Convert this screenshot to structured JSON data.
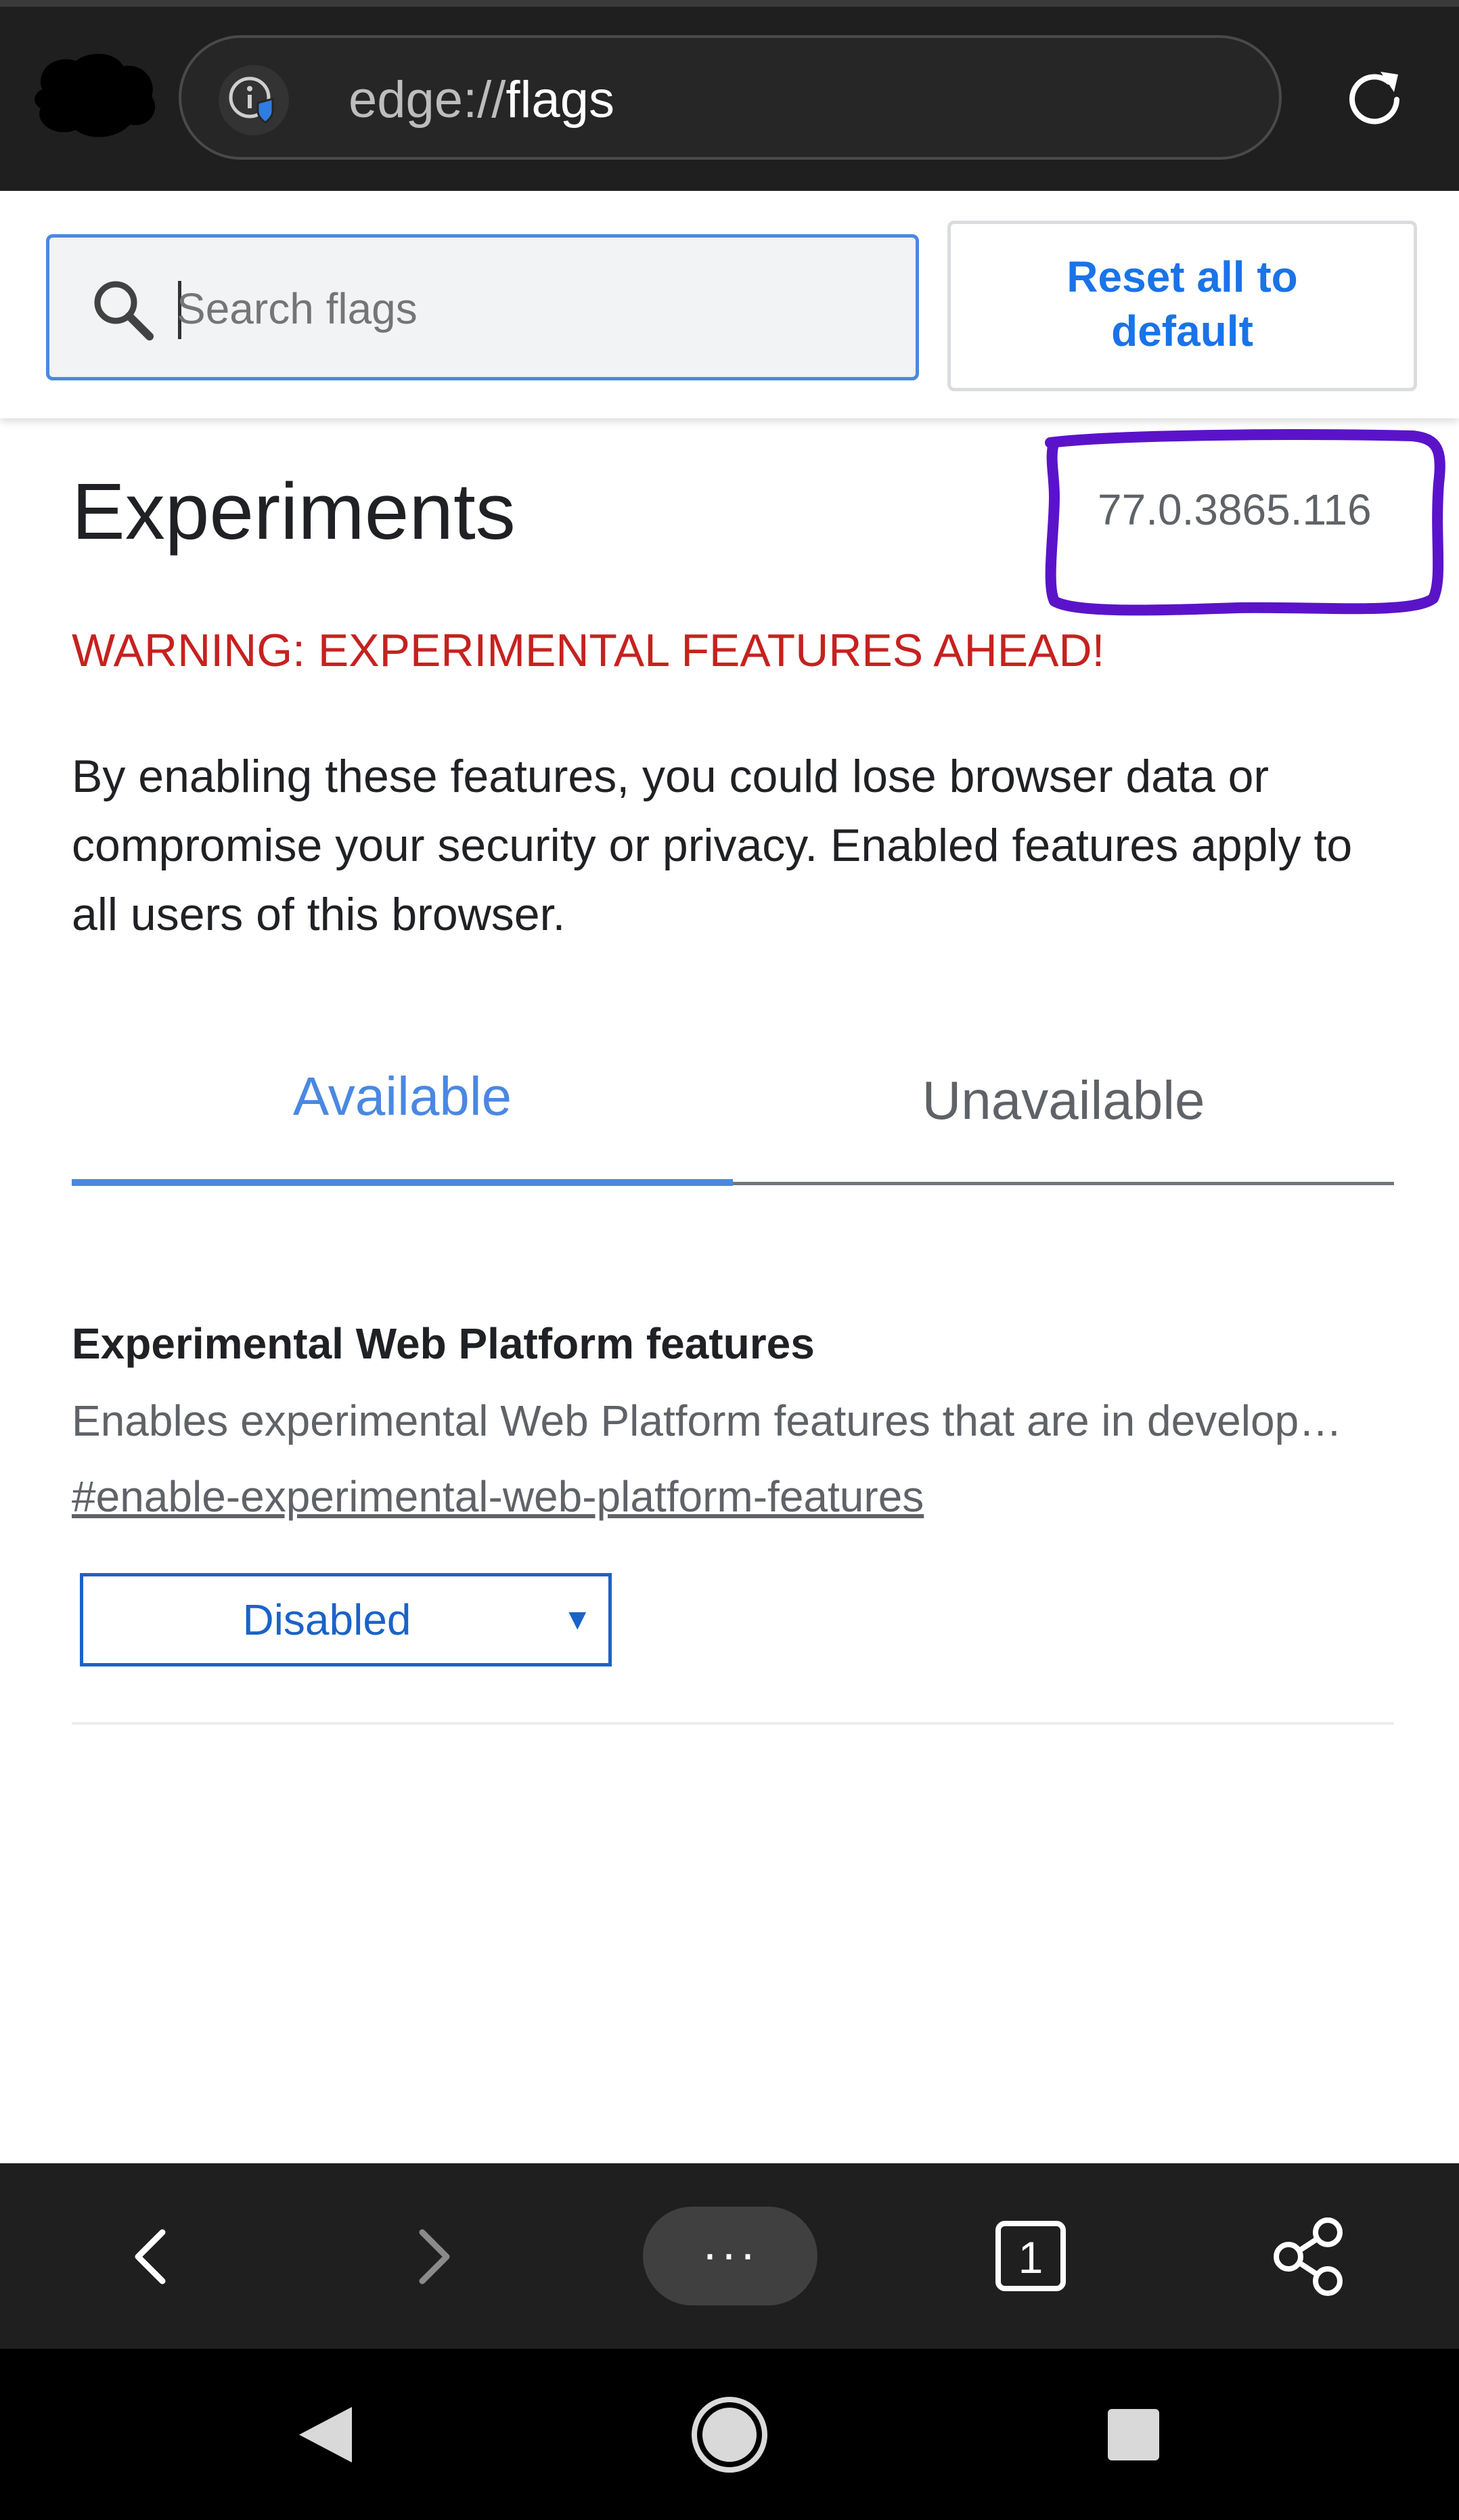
{
  "browser": {
    "url_scheme": "edge://",
    "url_path": "flags"
  },
  "header": {
    "search_placeholder": "Search flags",
    "reset_label": "Reset all to default"
  },
  "main": {
    "title": "Experiments",
    "version": "77.0.3865.116",
    "warning": "WARNING: EXPERIMENTAL FEATURES AHEAD!",
    "description": "By enabling these features, you could lose browser data or compromise your security or privacy. Enabled features apply to all users of this browser.",
    "tabs": [
      {
        "label": "Available",
        "selected": true
      },
      {
        "label": "Unavailable",
        "selected": false
      }
    ]
  },
  "flags": [
    {
      "title": "Experimental Web Platform features",
      "description": "Enables experimental Web Platform features that are in development.",
      "link": "#enable-experimental-web-platform-features",
      "value": "Disabled"
    }
  ],
  "toolbar": {
    "more_label": "···",
    "tab_count": "1"
  },
  "colors": {
    "accent": "#4a88e0",
    "warning": "#c5221f",
    "annotation": "#5b13c9",
    "bar_bg": "#1f1f1f"
  },
  "icons": [
    "site-info-icon",
    "reload-icon",
    "search-icon",
    "back-arrow-icon",
    "forward-arrow-icon",
    "more-icon",
    "tabs-icon",
    "share-icon",
    "nav-back-icon",
    "nav-home-icon",
    "nav-recents-icon"
  ]
}
